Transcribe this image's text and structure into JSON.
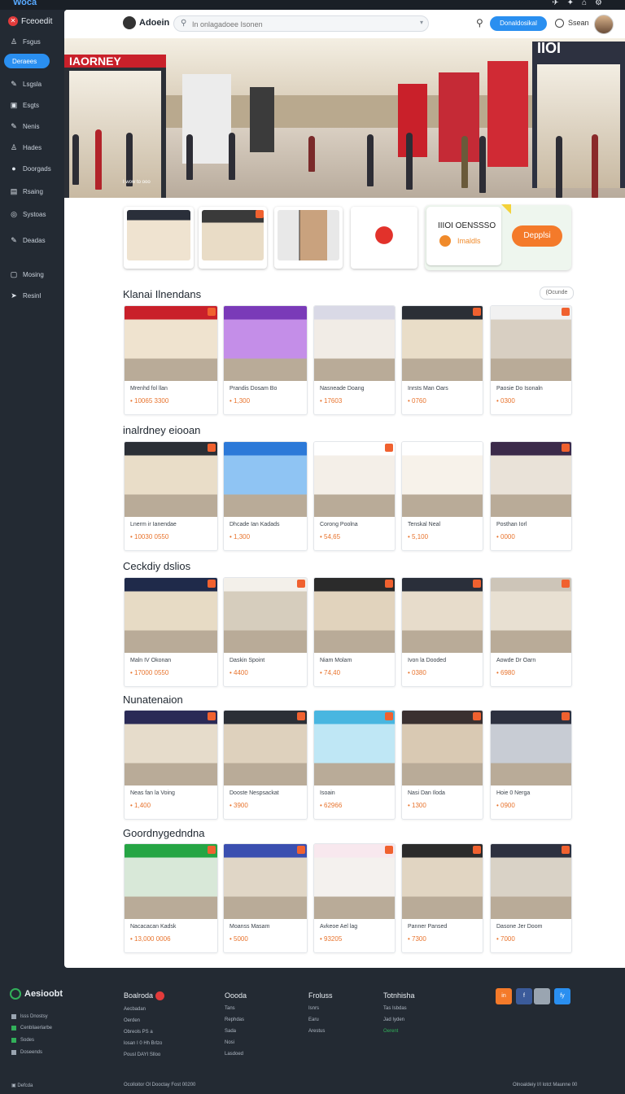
{
  "topbar": {
    "brand": "Woca",
    "icons": [
      "bird-icon",
      "pin-icon",
      "home-icon",
      "settings-icon"
    ]
  },
  "sidebar": {
    "logo": "Fceoedit",
    "items": [
      {
        "label": "Fsgus",
        "icon": "user-icon"
      },
      {
        "label": "Deraees",
        "icon": "",
        "active": true
      },
      {
        "label": "Lsgsla",
        "icon": "pen-icon"
      },
      {
        "label": "Esgts",
        "icon": "square-icon"
      },
      {
        "label": "Nenis",
        "icon": "pen-icon"
      },
      {
        "label": "Hades",
        "icon": "user-icon"
      },
      {
        "label": "Doorgads",
        "icon": "circle-icon"
      },
      {
        "label": "Rsaing",
        "icon": "list-icon"
      },
      {
        "label": "Systoas",
        "icon": "globe-icon"
      },
      {
        "label": "Deadas",
        "icon": "pen-icon"
      },
      {
        "label": "Mosing",
        "icon": "square-icon"
      },
      {
        "label": "Resinl",
        "icon": "arrow-icon"
      }
    ]
  },
  "header": {
    "title": "Adoein",
    "search_placeholder": "In onlagadoee Isonen",
    "button": "Donaldosikal",
    "status": "Ssean"
  },
  "hero": {
    "sign_left": "IAORNEY",
    "sign_right": "IIOI",
    "caption": "I wow to ooo"
  },
  "promo": {
    "title": "IIIOI OENSSSO",
    "subtitle": "Imaldls",
    "button": "Depplsi"
  },
  "sections": [
    {
      "title": "Klanai Ilnendans",
      "link": "(Ocunde",
      "items": [
        {
          "name": "Mrenhd fol llan",
          "price": "• 10065 3300"
        },
        {
          "name": "Prandis Dosam Bo",
          "price": "• 1,300"
        },
        {
          "name": "Nasneade Doang",
          "price": "• 17603"
        },
        {
          "name": "Inrsts Man Oars",
          "price": "• 0760"
        },
        {
          "name": "Paosie Do Isonaln",
          "price": "• 0300"
        }
      ]
    },
    {
      "title": "inalrdney eiooan",
      "items": [
        {
          "name": "Lnerm ir Ianendae",
          "price": "• 10030 0550"
        },
        {
          "name": "Dhcade Ian Kadads",
          "price": "• 1,300"
        },
        {
          "name": "Corong Poolna",
          "price": "• 54,65"
        },
        {
          "name": "Tenskal Neal",
          "price": "• 5,100"
        },
        {
          "name": "Posthan Iorl",
          "price": "• 0000"
        }
      ]
    },
    {
      "title": "Ceckdiy dslios",
      "items": [
        {
          "name": "Maln IV Okonan",
          "price": "• 17000 0550"
        },
        {
          "name": "Daskin Spoint",
          "price": "• 4400"
        },
        {
          "name": "Niam Molam",
          "price": "• 74,40"
        },
        {
          "name": "Ivon la Dooded",
          "price": "• 0380"
        },
        {
          "name": "Aowde Dr Oarn",
          "price": "• 6980"
        }
      ]
    },
    {
      "title": "Nunatenaion",
      "items": [
        {
          "name": "Neas fan la Voing",
          "price": "• 1,400"
        },
        {
          "name": "Dooste Nespsackat",
          "price": "• 3900"
        },
        {
          "name": "Isoain",
          "price": "• 62966"
        },
        {
          "name": "Nasi Dan Iloda",
          "price": "• 1300"
        },
        {
          "name": "Hoie 0 Nerga",
          "price": "• 0900"
        }
      ]
    },
    {
      "title": "Goordnygedndna",
      "items": [
        {
          "name": "Nacacacan Kadsk",
          "price": "• 13,000 0006"
        },
        {
          "name": "Moanss Masam",
          "price": "• 5000"
        },
        {
          "name": "Avkeoe Ael lag",
          "price": "• 93205"
        },
        {
          "name": "Panner Pansed",
          "price": "• 7300"
        },
        {
          "name": "Dasone Jer Doom",
          "price": "• 7000"
        }
      ]
    }
  ],
  "footer": {
    "logo": "Aesioobt",
    "left_items": [
      "lsss Dnostsy",
      "Cenbliaerlarbe",
      "Sodes",
      "Doseends"
    ],
    "columns": [
      {
        "heading": "Boalroda",
        "items": [
          "Aecbadan",
          "Oerden",
          "Obreols PS a",
          "losan I 0 Hh Brlzo",
          "Pousl DAYI Slloo"
        ]
      },
      {
        "heading": "Oooda",
        "items": [
          "Tans",
          "Rephdas",
          "Sada",
          "Nosi",
          "Lasdoed"
        ]
      },
      {
        "heading": "Froluss",
        "items": [
          "Isnrs",
          "Earu",
          "Arestus"
        ]
      },
      {
        "heading": "Totnhisha",
        "items": [
          "Tas Isbdas",
          "Jad Iyden",
          "Oerent"
        ]
      }
    ],
    "social": [
      "in",
      "f",
      "",
      "fy"
    ],
    "bottom_left": "Defcda",
    "bottom_center": "Ocolloitor Ol Dooctay Fost 00200",
    "bottom_right": "Olnoaldeiy I/I lotct Maunne 00"
  }
}
